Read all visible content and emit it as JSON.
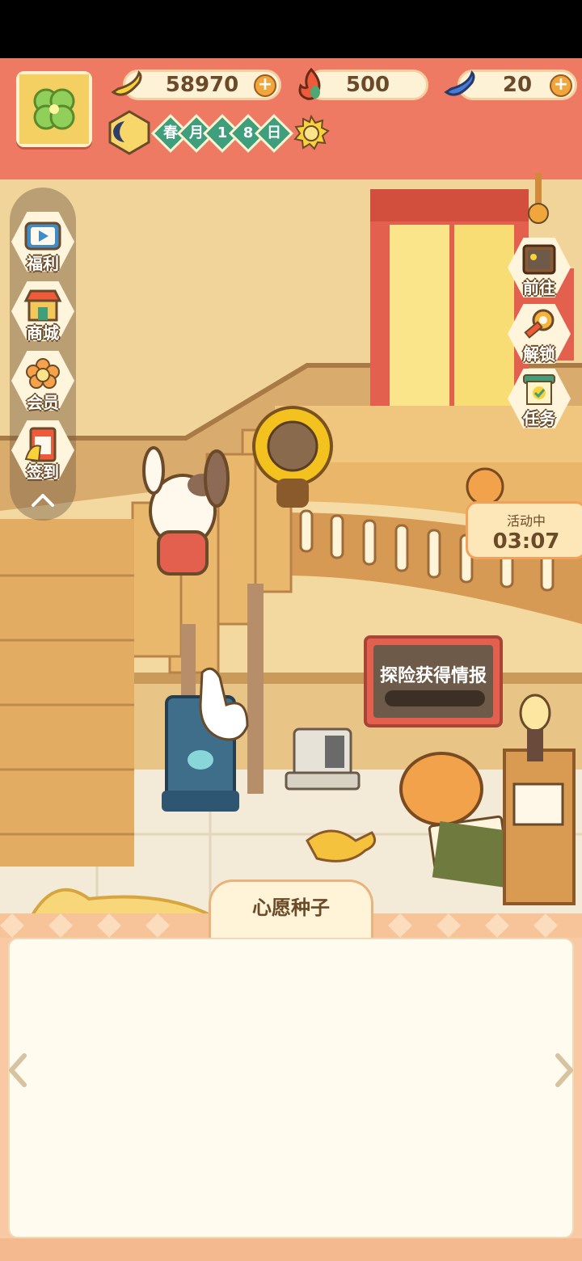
{
  "header": {
    "banana_amount": "58970",
    "fire_amount": "500",
    "gem_amount": "20",
    "season": "春",
    "month_label": "月",
    "day_digit_1": "1",
    "day_digit_2": "8",
    "day_label": "日"
  },
  "left_menu": {
    "items": [
      {
        "label": "福利",
        "icon": "tv-icon"
      },
      {
        "label": "商城",
        "icon": "shop-icon"
      },
      {
        "label": "会员",
        "icon": "flower-crown-icon"
      },
      {
        "label": "签到",
        "icon": "calendar-icon"
      }
    ],
    "collapse_icon": "chevron-up-icon"
  },
  "right_menu": {
    "items": [
      {
        "label": "前往",
        "icon": "board-icon"
      },
      {
        "label": "解锁",
        "icon": "key-icon"
      },
      {
        "label": "任务",
        "icon": "task-icon"
      }
    ]
  },
  "event": {
    "label": "活动中",
    "time": "03:07"
  },
  "scene": {
    "intel_board_text": "探险获得情报"
  },
  "bottom_panel": {
    "tab_label": "心愿种子"
  },
  "colors": {
    "header": "#ef7a63",
    "panel": "#fffbee",
    "accent": "#f0a63b"
  }
}
